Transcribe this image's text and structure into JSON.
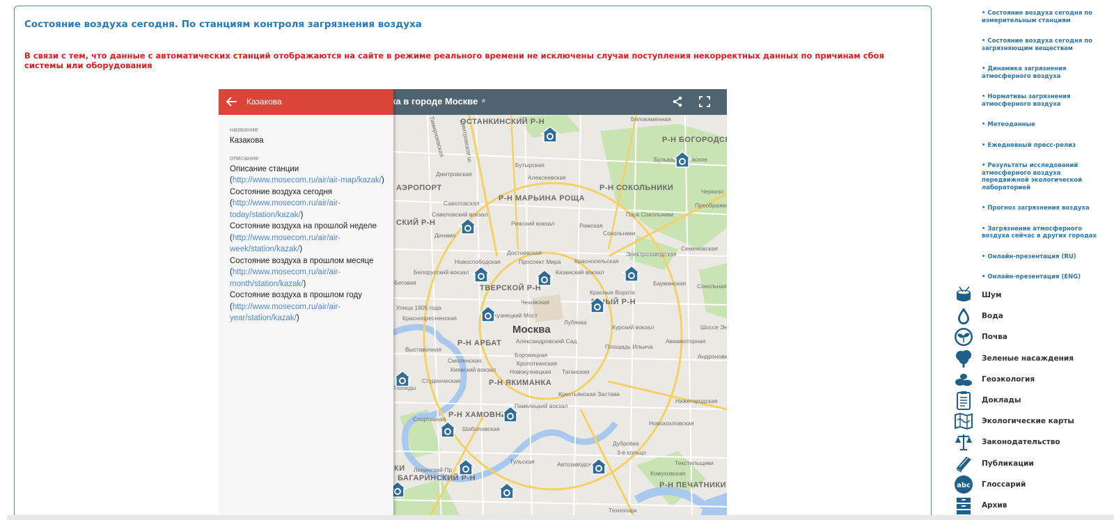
{
  "page": {
    "title": "Состояние воздуха сегодня. По станциям контроля загрязнения воздуха",
    "warning": "В связи с тем, что данные с автоматических станций отображаются на сайте в режиме реального времени не исключены случаи поступления некорректных данных по причинам сбоя системы или оборудования"
  },
  "map": {
    "title": "ка в городе Москве",
    "share_icon": "share-icon",
    "fullscreen_icon": "fullscreen-icon",
    "station_icon": "station-marker-icon",
    "city_label": "Москва",
    "district_labels": [
      "ОСТАНКИНСКИЙ Р-Н",
      "Р-Н БОГОРОДСКОЕ",
      "Р-Н МАРЬИНА РОЩА",
      "Р-Н СОКОЛЬНИКИ",
      "АЭРОПОРТ",
      "СКИЙ Р-Н",
      "ТВЕРСКОЙ Р-Н",
      "Б НЫЙ Р-Н",
      "Р-Н АРБАТ",
      "Р-Н ЯКИМАНКА",
      "Р-Н ХАМОВНИКИ",
      "БАГАРИНСКИЙ Р-Н",
      "Р-Н ПЕЧАТНИКИ",
      "КИ"
    ],
    "street_labels": [
      "Белокаменная",
      "Бульвар Р",
      "вское",
      "Бутырская",
      "Алексеевская",
      "Дмитровская",
      "Савеловский вокзал",
      "Савеловская",
      "Рижская",
      "Рижский вокзал",
      "Сокольники",
      "Черкизо",
      "Преображенская Площадь",
      "Парк Сокольники",
      "Динамо",
      "Новослободская",
      "Достоевская",
      "Электрозаводская",
      "Семеновская",
      "Белорусский вокзал",
      "Проспект Мира",
      "Красносельская",
      "Казанский вокзал",
      "Бауманская",
      "Сокольная",
      "Беговая",
      "Чеховская",
      "Красные Ворота",
      "Улица 1905 года",
      "Краснопресненская",
      "Кузнецкий Мост",
      "Лубянка",
      "Курский вокзал",
      "Шоссе Эн",
      "Выставочная",
      "Александровский Сад",
      "Площадь Ильича",
      "Авиамоторная",
      "Андроновк",
      "Смоленская",
      "Кропоткинская",
      "Киевский вокзал",
      "Новокузнецкая",
      "Таганская",
      "Студенческая",
      "Крестьянская Застава",
      "Павелецкий вокзал",
      "Нижегородская",
      "Спортивная",
      "Шаболовская",
      "Новохохловская",
      "Дубровка",
      "Тульская",
      "Автозаводская",
      "Текстильщики",
      "Ленинский Пр",
      "Кожуховская",
      "3-е кольцо",
      "Технопарк",
      "Победы",
      "Боровицкая",
      "Дмитровское ш.",
      "Тимирязевская"
    ],
    "map_attribution_icon": "map-attribution-icon"
  },
  "info": {
    "header_title": "Казакова",
    "name_label": "название",
    "name_value": "Казакова",
    "desc_label": "описание",
    "desc_intro": "Описание станции",
    "link1_url": "http://www.mosecom.ru/air/air-map/kazak/",
    "link1_title": "Состояние воздуха сегодня",
    "link2_url": "http://www.mosecom.ru/air/air-today/station/kazak/",
    "link2_title": "Состояние воздуха на прошлой неделе",
    "link3_url": "http://www.mosecom.ru/air/air-week/station/kazak/",
    "link3_title": "Состояние воздуха в прошлом месяце",
    "link4_url": "http://www.mosecom.ru/air/air-month/station/kazak/",
    "link4_title": "Состояние воздуха в прошлом году",
    "link5_url": "http://www.mosecom.ru/air/air-year/station/kazak/",
    "open_paren": "(",
    "close_paren": ")"
  },
  "sidebar": {
    "links": [
      "• Состояние воздуха сегодня по измерительным станциям",
      "• Состояние воздуха сегодня по загрязняющим веществам",
      "• Динамика загрязнения атмосферного воздуха",
      "• Нормативы загрязнения атмосферного воздуха",
      "• Метеоданные",
      "• Ежедневный пресс-релиз",
      "• Результаты исследований атмосферного воздуха передвижной экологической лабораторией",
      "• Прогноз загрязнения воздуха",
      "• Загрязнение атмосферного воздуха сейчас в других городах",
      "• Онлайн-презентация (RU)",
      "• Онлайн-презентация (ENG)"
    ],
    "categories": [
      {
        "label": "Шум",
        "icon": "drum-icon"
      },
      {
        "label": "Вода",
        "icon": "water-drop-icon"
      },
      {
        "label": "Почва",
        "icon": "sprout-icon"
      },
      {
        "label": "Зеленые насаждения",
        "icon": "tree-icon"
      },
      {
        "label": "Геоэкология",
        "icon": "stones-icon"
      },
      {
        "label": "Доклады",
        "icon": "clipboard-icon"
      },
      {
        "label": "Экологические карты",
        "icon": "map-icon"
      },
      {
        "label": "Законодательство",
        "icon": "scales-icon"
      },
      {
        "label": "Публикации",
        "icon": "book-icon"
      },
      {
        "label": "Глоссарий",
        "icon": "abc-icon"
      },
      {
        "label": "Архив",
        "icon": "archive-icon"
      }
    ]
  },
  "colors": {
    "accent": "#2b78b5",
    "warning": "#e01b1b",
    "map_header": "#4e6470",
    "info_header": "#db4437",
    "link": "#4f88d8",
    "marker": "#2f6c98",
    "category_icon": "#1f5f8b"
  }
}
